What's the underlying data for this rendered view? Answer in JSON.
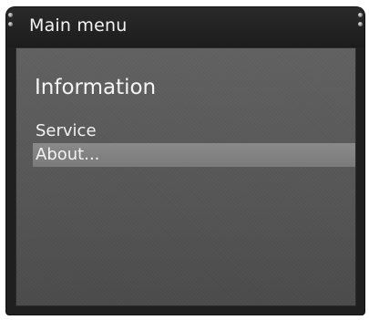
{
  "window": {
    "title": "Main menu"
  },
  "section": {
    "heading": "Information"
  },
  "menu": {
    "items": [
      {
        "label": "Service",
        "selected": false
      },
      {
        "label": "About...",
        "selected": true
      }
    ]
  },
  "colors": {
    "frame": "#1f1f1f",
    "panel": "#585858",
    "highlight": "#828282",
    "text": "#f2f2f2"
  }
}
